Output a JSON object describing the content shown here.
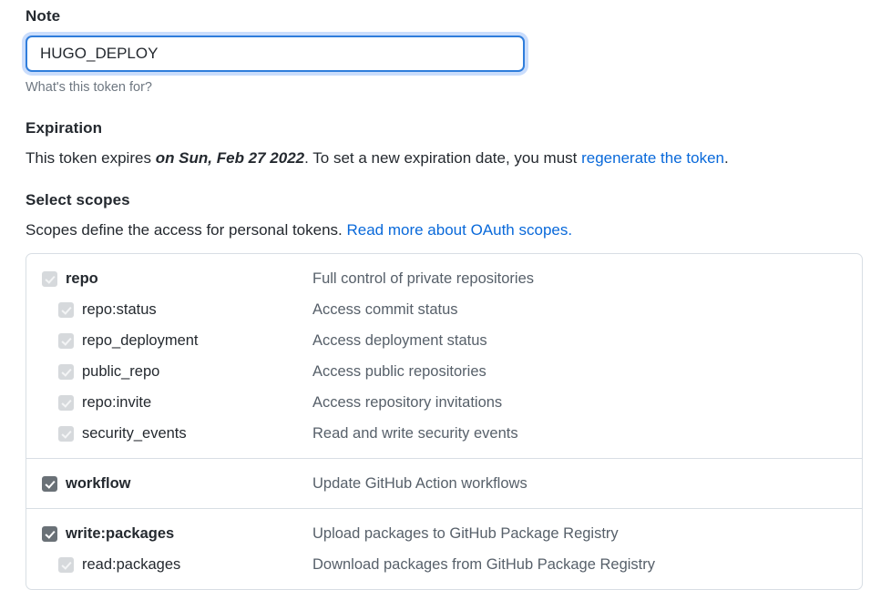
{
  "note": {
    "label": "Note",
    "value": "HUGO_DEPLOY",
    "placeholder": "What's this token for?",
    "help": "What's this token for?"
  },
  "expiration": {
    "title": "Expiration",
    "text_before": "This token expires ",
    "date": "on Sun, Feb 27 2022",
    "text_middle": ". To set a new expiration date, you must ",
    "link": "regenerate the token",
    "text_after": "."
  },
  "scopes": {
    "title": "Select scopes",
    "subtitle_before": "Scopes define the access for personal tokens. ",
    "subtitle_link": "Read more about OAuth scopes.",
    "groups": [
      {
        "rows": [
          {
            "name": "repo",
            "desc": "Full control of private repositories",
            "checked": true,
            "disabled": true,
            "sub": false
          },
          {
            "name": "repo:status",
            "desc": "Access commit status",
            "checked": true,
            "disabled": true,
            "sub": true
          },
          {
            "name": "repo_deployment",
            "desc": "Access deployment status",
            "checked": true,
            "disabled": true,
            "sub": true
          },
          {
            "name": "public_repo",
            "desc": "Access public repositories",
            "checked": true,
            "disabled": true,
            "sub": true
          },
          {
            "name": "repo:invite",
            "desc": "Access repository invitations",
            "checked": true,
            "disabled": true,
            "sub": true
          },
          {
            "name": "security_events",
            "desc": "Read and write security events",
            "checked": true,
            "disabled": true,
            "sub": true
          }
        ]
      },
      {
        "rows": [
          {
            "name": "workflow",
            "desc": "Update GitHub Action workflows",
            "checked": true,
            "disabled": false,
            "sub": false
          }
        ]
      },
      {
        "rows": [
          {
            "name": "write:packages",
            "desc": "Upload packages to GitHub Package Registry",
            "checked": true,
            "disabled": false,
            "sub": false
          },
          {
            "name": "read:packages",
            "desc": "Download packages from GitHub Package Registry",
            "checked": true,
            "disabled": true,
            "sub": true
          }
        ]
      }
    ]
  },
  "colors": {
    "link": "#0969da",
    "focus_border": "#2f7ddb",
    "focus_ring": "#8ab4f8",
    "box_border": "#d8dee4",
    "checkbox_enabled": "#6a7177",
    "checkbox_disabled": "#d6d9dc",
    "description_text": "#57606a",
    "helper_text": "#6e7781"
  }
}
